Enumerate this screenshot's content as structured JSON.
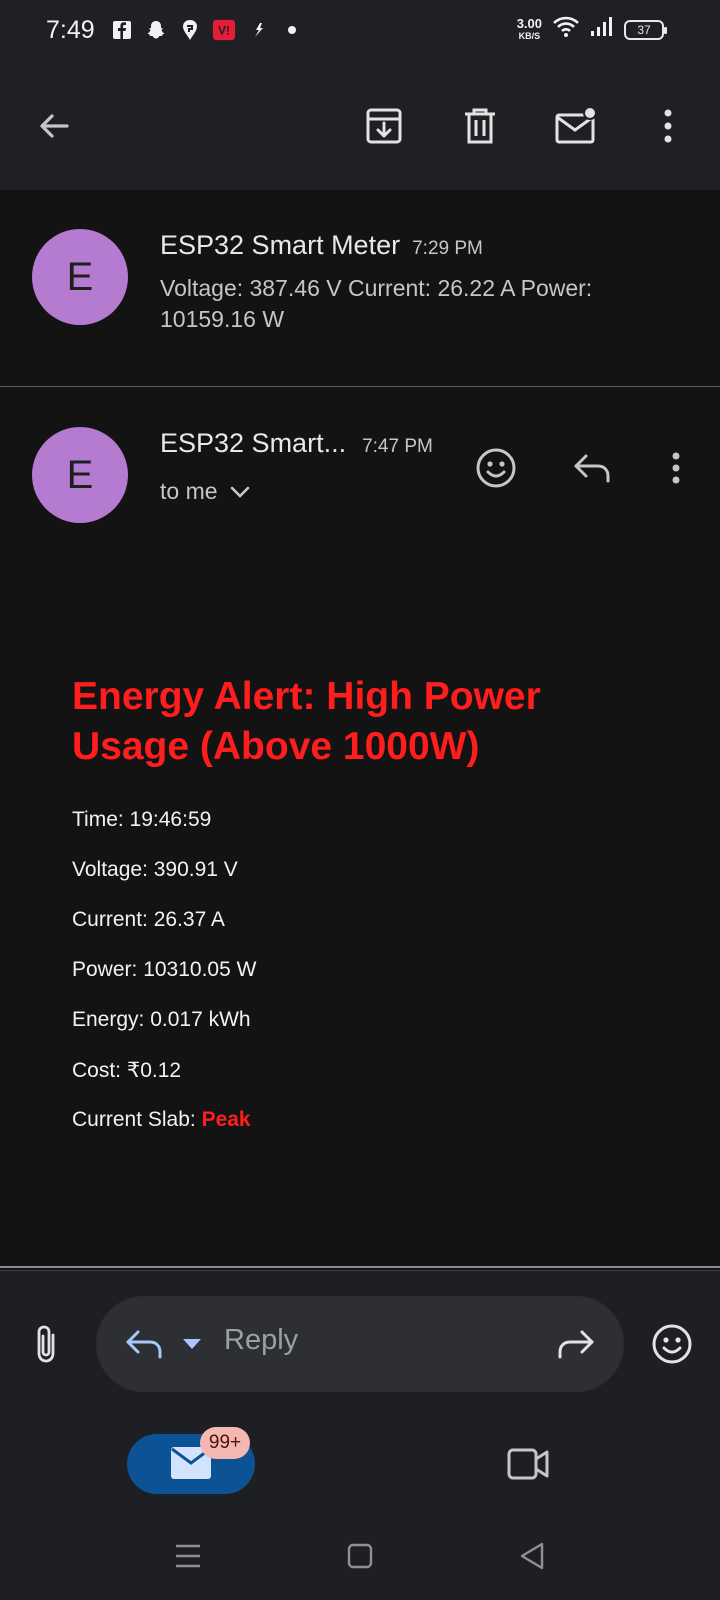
{
  "status_bar": {
    "time": "7:49",
    "net_speed_value": "3.00",
    "net_speed_unit": "KB/S",
    "battery": "37",
    "app_icons": [
      "facebook-icon",
      "snapchat-icon",
      "swiggy-icon",
      "vi-icon",
      "flipkart-icon",
      "dot-icon"
    ]
  },
  "toolbar": {
    "icons": [
      "back-arrow-icon",
      "archive-icon",
      "delete-icon",
      "mark-unread-icon",
      "more-vert-icon"
    ]
  },
  "messages": [
    {
      "avatar_letter": "E",
      "sender": "ESP32 Smart Meter",
      "time": "7:29 PM",
      "snippet_line1": "Voltage: 387.46 V Current: 26.22 A Power:",
      "snippet_line2": "10159.16 W"
    },
    {
      "avatar_letter": "E",
      "sender": "ESP32 Smart...",
      "time": "7:47 PM",
      "recipient": "to me"
    }
  ],
  "email_body": {
    "title_line1": "Energy Alert: High Power",
    "title_line2": "Usage (Above 1000W)",
    "fields": [
      "Time: 19:46:59",
      "Voltage: 390.91 V",
      "Current: 26.37 A",
      "Power: 10310.05 W",
      "Energy: 0.017 kWh",
      "Cost: ₹0.12"
    ],
    "slab_label": "Current Slab: ",
    "slab_value": "Peak"
  },
  "reply_bar": {
    "placeholder": "Reply"
  },
  "bottom_nav": {
    "mail_badge": "99+"
  },
  "colors": {
    "accent_red": "#ff1d1d",
    "avatar": "#b57bd0",
    "active_nav": "#0b5394"
  }
}
